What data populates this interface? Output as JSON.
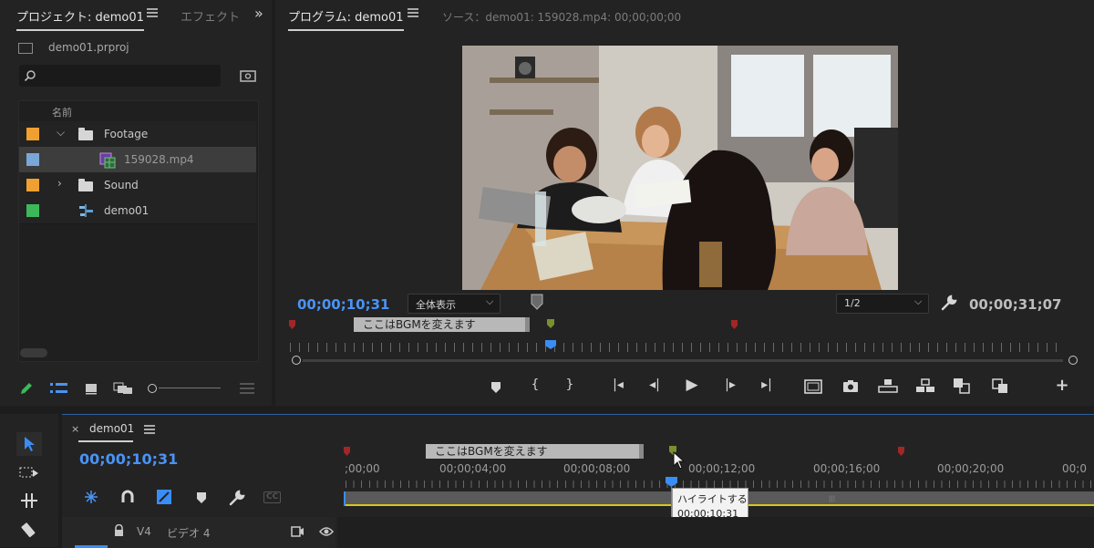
{
  "project_panel": {
    "tab_project": "プロジェクト: demo01",
    "tab_effects": "エフェクト",
    "file_name": "demo01.prproj",
    "search_placeholder": "",
    "column_name": "名前",
    "items": [
      {
        "label": "Footage",
        "color": "#f0a030"
      },
      {
        "label": "159028.mp4",
        "color": "#7aa7d6"
      },
      {
        "label": "Sound",
        "color": "#f0a030"
      },
      {
        "label": "demo01",
        "color": "#3cb85a"
      }
    ]
  },
  "program_monitor": {
    "tab_program": "プログラム: demo01",
    "tab_source": "ソース：demo01: 159028.mp4: 00;00;00;00",
    "current_timecode": "00;00;10;31",
    "zoom_select": "全体表示",
    "resolution_select": "1/2",
    "duration_timecode": "00;00;31;07",
    "marker_label": "ここはBGMを変えます"
  },
  "timeline": {
    "sequence_name": "demo01",
    "current_timecode": "00;00;10;31",
    "marker_label": "ここはBGMを変えます",
    "ruler_labels": [
      ";00;00",
      "00;00;04;00",
      "00;00;08;00",
      "00;00;12;00",
      "00;00;16;00",
      "00;00;20;00",
      "00;0"
    ],
    "tooltip_title": "ハイライトする",
    "tooltip_timecode": "00;00;10;31",
    "track_name": "V4",
    "track_label": "ビデオ 4",
    "cc_label": "CC"
  },
  "colors": {
    "accent_blue": "#4a93f5",
    "marker_green": "#7a8f2e",
    "marker_red": "#a32626",
    "work_area_yellow": "#d9c81a"
  }
}
